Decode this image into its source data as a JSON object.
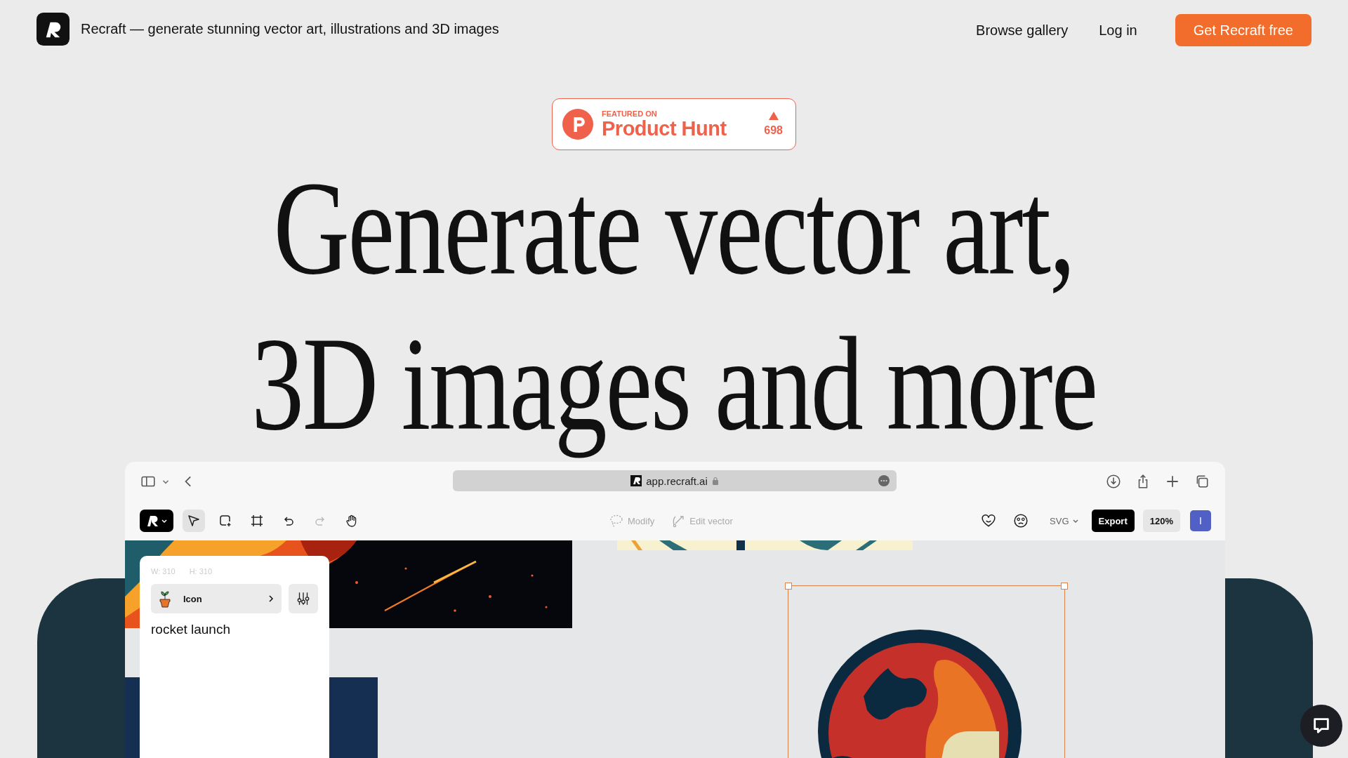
{
  "header": {
    "brand": "Recraft — generate stunning vector art, illustrations and 3D images",
    "nav": [
      "Browse gallery",
      "Log in"
    ],
    "cta": "Get Recraft free"
  },
  "badge": {
    "overline": "FEATURED ON",
    "title": "Product Hunt",
    "votes": "698"
  },
  "headline": [
    "Generate vector art,",
    "3D images and more"
  ],
  "browser": {
    "url": "app.recraft.ai"
  },
  "toolbar": {
    "tools": [
      {
        "kind": "select",
        "selected": true,
        "disabled": false
      },
      {
        "kind": "frame",
        "selected": false,
        "disabled": false
      },
      {
        "kind": "crop",
        "selected": false,
        "disabled": false
      },
      {
        "kind": "undo",
        "selected": false,
        "disabled": false
      },
      {
        "kind": "redo",
        "selected": false,
        "disabled": true
      },
      {
        "kind": "hand",
        "selected": false,
        "disabled": false
      }
    ],
    "actions": [
      {
        "kind": "modify",
        "label": "Modify",
        "disabled": true
      },
      {
        "kind": "edit",
        "label": "Edit vector",
        "disabled": true
      }
    ],
    "format": "SVG",
    "export": "Export",
    "zoom": "120%",
    "avatar": "I"
  },
  "panel": {
    "width": "W: 310",
    "height": "H: 310",
    "style": "Icon",
    "prompt": "rocket launch"
  }
}
